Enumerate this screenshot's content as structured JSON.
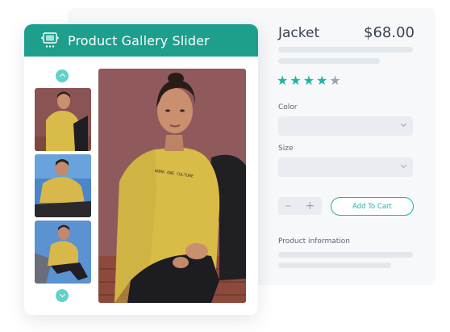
{
  "gallery": {
    "title": "Product Gallery Slider",
    "icon": "slider-icon",
    "accent_color": "#1e9e8c"
  },
  "product": {
    "title": "Jacket",
    "price": "$68.00",
    "rating": 4,
    "rating_max": 5,
    "color_label": "Color",
    "size_label": "Size",
    "stepper_minus": "–",
    "stepper_plus": "+",
    "add_to_cart_label": "Add To Cart",
    "info_label": "Product information"
  }
}
